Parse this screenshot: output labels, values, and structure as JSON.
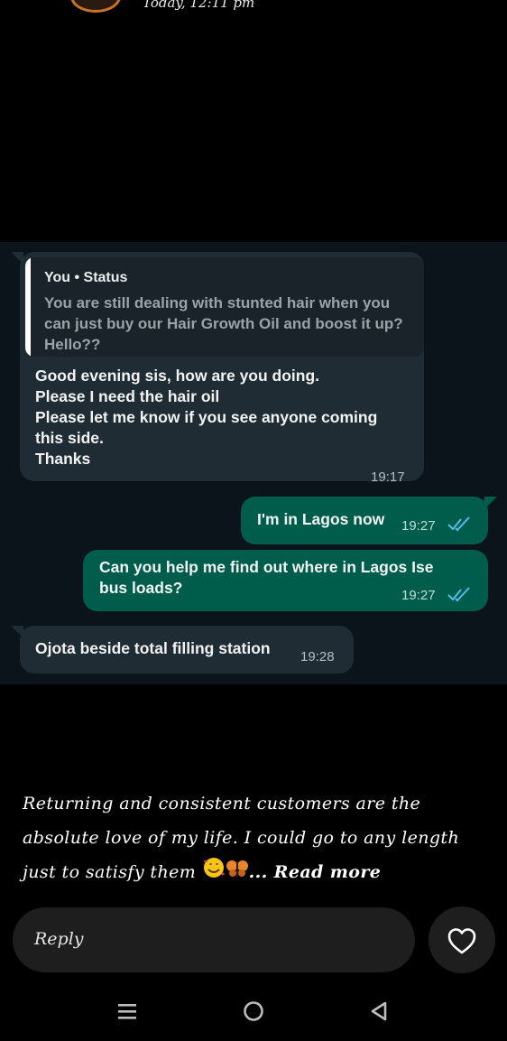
{
  "header": {
    "post_time": "Today, 12:11 pm"
  },
  "chat": {
    "quoted_message": {
      "author": "You • Status",
      "text": "You are still dealing with stunted hair when you can just buy our Hair Growth Oil and boost it up? Hello??"
    },
    "messages": [
      {
        "direction": "incoming",
        "lines": [
          "Good evening sis, how are you doing.",
          "Please I need the hair oil",
          "Please let me know if you see anyone coming",
          "this side.",
          "Thanks"
        ],
        "time": "19:17"
      },
      {
        "direction": "outgoing",
        "text": "I'm in Lagos now",
        "time": "19:27",
        "status": "read"
      },
      {
        "direction": "outgoing",
        "lines": [
          "Can you help me find out where in Lagos Ise",
          "bus loads?"
        ],
        "time": "19:27",
        "status": "read"
      },
      {
        "direction": "incoming",
        "text": "Ojota beside total filling station",
        "time": "19:28"
      }
    ]
  },
  "story": {
    "caption": "Returning and consistent customers are the absolute love of my life. I could go to any length just to satisfy them",
    "emojis": [
      "smiling-face-with-hearts",
      "butterfly"
    ],
    "read_more": "... Read more"
  },
  "reply": {
    "placeholder": "Reply"
  },
  "icons": {
    "like": "heart-icon",
    "read_receipt": "double-check-icon"
  },
  "nav": {
    "buttons": [
      "recent-apps-icon",
      "home-icon",
      "back-icon"
    ]
  },
  "colors": {
    "chat_background": "#0b141a",
    "incoming_bubble": "#1f2c34",
    "outgoing_bubble": "#005c4b",
    "read_tick": "#53bdeb",
    "page_background": "#000000"
  }
}
